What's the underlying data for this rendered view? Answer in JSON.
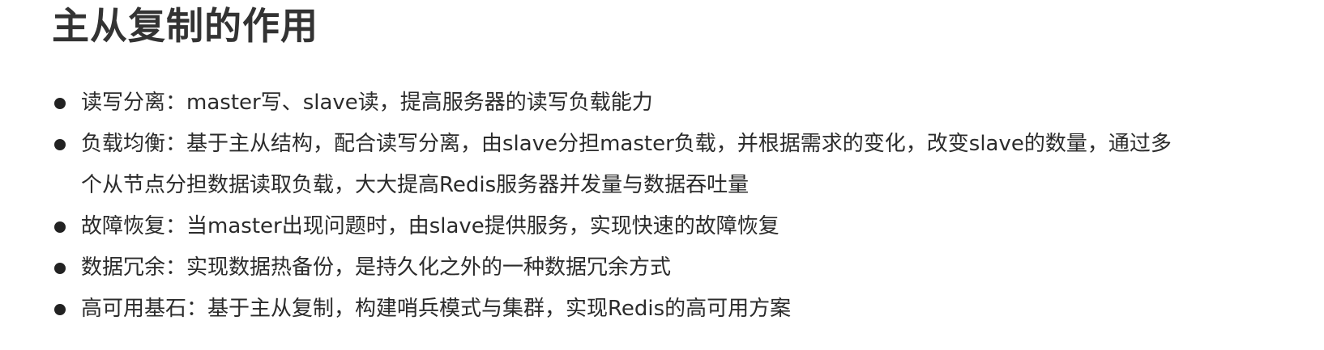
{
  "title": "主从复制的作用",
  "bullets": [
    {
      "label": "读写分离：",
      "text": "master写、slave读，提高服务器的读写负载能力"
    },
    {
      "label": "负载均衡：",
      "text": "基于主从结构，配合读写分离，由slave分担master负载，并根据需求的变化，改变slave的数量，通过多个从节点分担数据读取负载，大大提高Redis服务器并发量与数据吞吐量"
    },
    {
      "label": "故障恢复：",
      "text": "当master出现问题时，由slave提供服务，实现快速的故障恢复"
    },
    {
      "label": "数据冗余：",
      "text": "实现数据热备份，是持久化之外的一种数据冗余方式"
    },
    {
      "label": "高可用基石：",
      "text": "基于主从复制，构建哨兵模式与集群，实现Redis的高可用方案"
    }
  ]
}
